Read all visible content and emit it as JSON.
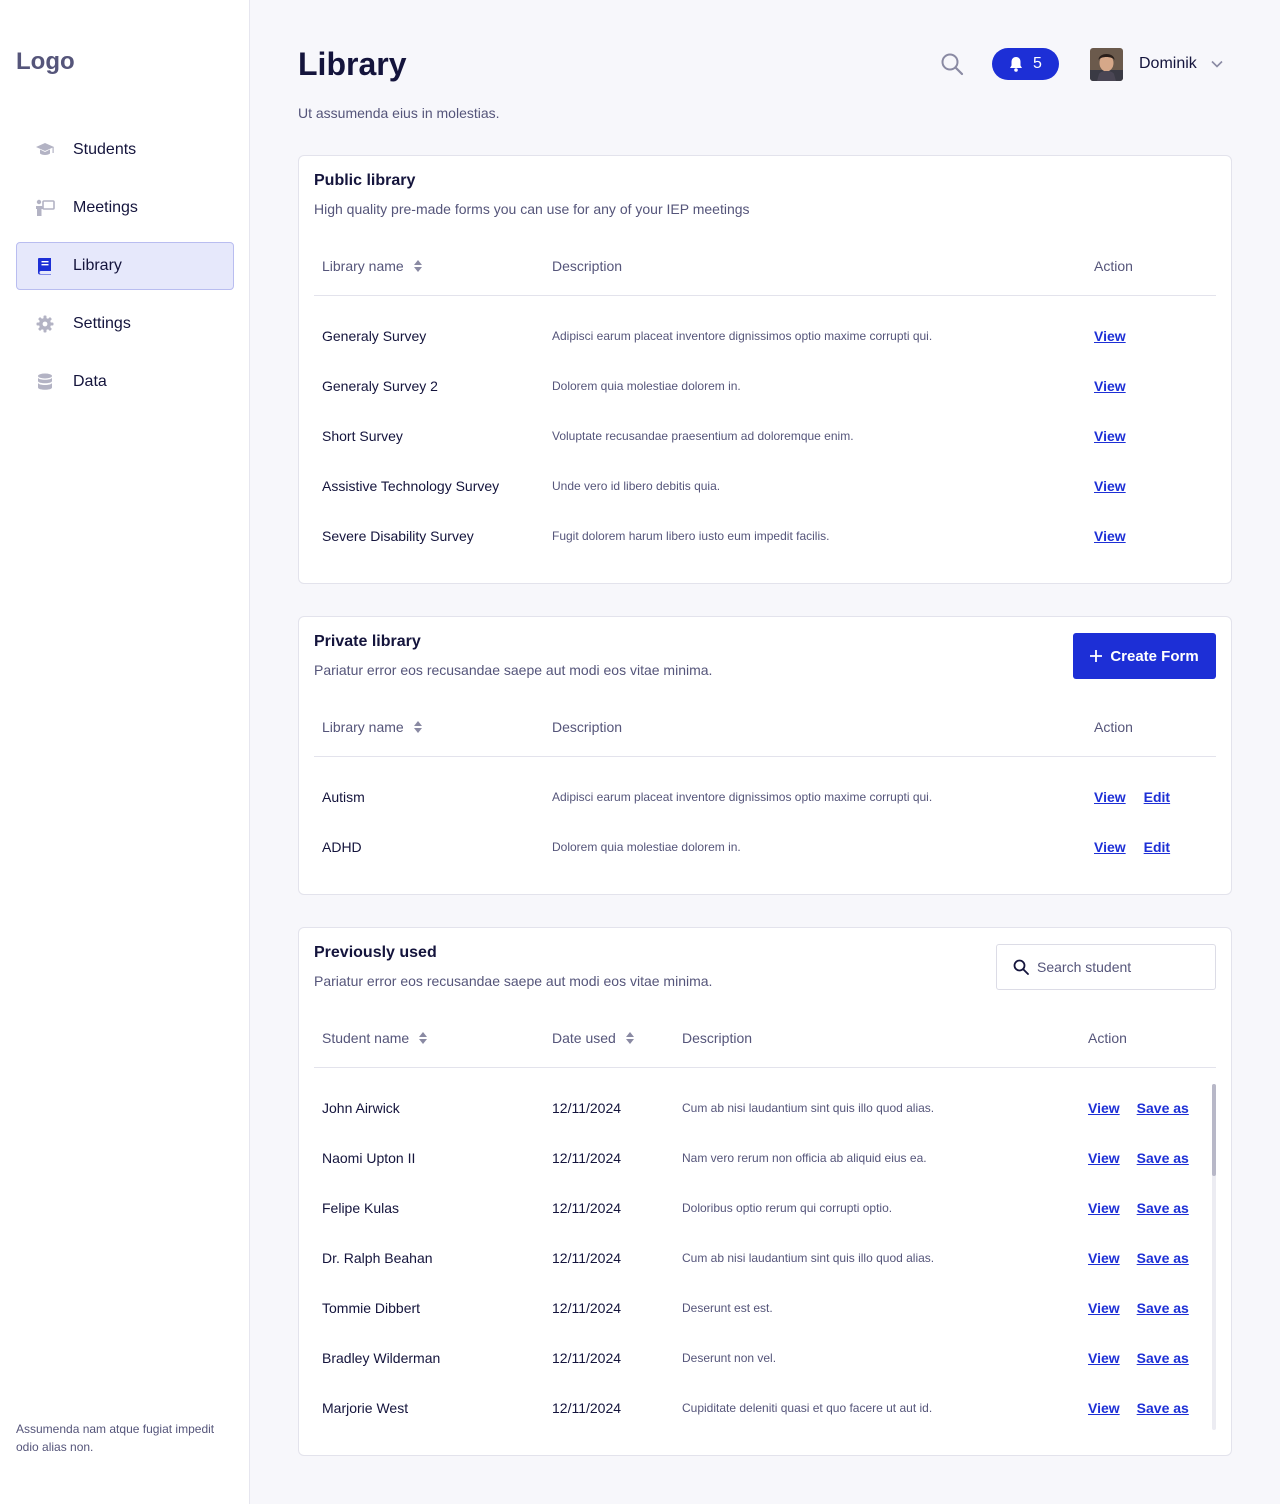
{
  "sidebar": {
    "logo": "Logo",
    "items": [
      {
        "label": "Students",
        "icon": "graduation-cap-icon"
      },
      {
        "label": "Meetings",
        "icon": "presentation-icon"
      },
      {
        "label": "Library",
        "icon": "book-icon",
        "active": true
      },
      {
        "label": "Settings",
        "icon": "gear-icon"
      },
      {
        "label": "Data",
        "icon": "database-icon"
      }
    ],
    "footer": "Assumenda nam atque fugiat impedit odio alias non."
  },
  "header": {
    "title": "Library",
    "subtitle": "Ut assumenda eius in molestias.",
    "notifications": "5",
    "user_name": "Dominik"
  },
  "public_library": {
    "title": "Public library",
    "subtitle": "High quality pre-made forms you can use for any of your IEP meetings",
    "columns": {
      "name": "Library name",
      "description": "Description",
      "action": "Action"
    },
    "rows": [
      {
        "name": "Generaly Survey",
        "description": "Adipisci earum placeat inventore dignissimos optio maxime corrupti qui.",
        "view": "View"
      },
      {
        "name": "Generaly Survey 2",
        "description": "Dolorem quia molestiae dolorem in.",
        "view": "View"
      },
      {
        "name": "Short Survey",
        "description": "Voluptate recusandae praesentium ad doloremque enim.",
        "view": "View"
      },
      {
        "name": "Assistive Technology Survey",
        "description": "Unde vero id libero debitis quia.",
        "view": "View"
      },
      {
        "name": "Severe Disability Survey",
        "description": "Fugit dolorem harum libero iusto eum impedit facilis.",
        "view": "View"
      }
    ]
  },
  "private_library": {
    "title": "Private library",
    "subtitle": "Pariatur error eos recusandae saepe aut modi eos vitae minima.",
    "create_label": "Create Form",
    "columns": {
      "name": "Library name",
      "description": "Description",
      "action": "Action"
    },
    "rows": [
      {
        "name": "Autism",
        "description": "Adipisci earum placeat inventore dignissimos optio maxime corrupti qui.",
        "view": "View",
        "edit": "Edit"
      },
      {
        "name": "ADHD",
        "description": "Dolorem quia molestiae dolorem in.",
        "view": "View",
        "edit": "Edit"
      }
    ]
  },
  "previously_used": {
    "title": "Previously used",
    "subtitle": "Pariatur error eos recusandae saepe aut modi eos vitae minima.",
    "search_placeholder": "Search student",
    "columns": {
      "name": "Student name",
      "date": "Date used",
      "description": "Description",
      "action": "Action"
    },
    "rows": [
      {
        "name": "John Airwick",
        "date": "12/11/2024",
        "description": "Cum ab nisi laudantium sint quis illo quod alias.",
        "view": "View",
        "save": "Save as"
      },
      {
        "name": "Naomi Upton II",
        "date": "12/11/2024",
        "description": "Nam vero rerum non officia ab aliquid eius ea.",
        "view": "View",
        "save": "Save as"
      },
      {
        "name": "Felipe Kulas",
        "date": "12/11/2024",
        "description": "Doloribus optio rerum qui corrupti optio.",
        "view": "View",
        "save": "Save as"
      },
      {
        "name": "Dr. Ralph Beahan",
        "date": "12/11/2024",
        "description": "Cum ab nisi laudantium sint quis illo quod alias.",
        "view": "View",
        "save": "Save as"
      },
      {
        "name": "Tommie Dibbert",
        "date": "12/11/2024",
        "description": "Deserunt est est.",
        "view": "View",
        "save": "Save as"
      },
      {
        "name": "Bradley Wilderman",
        "date": "12/11/2024",
        "description": "Deserunt non vel.",
        "view": "View",
        "save": "Save as"
      },
      {
        "name": "Marjorie West",
        "date": "12/11/2024",
        "description": "Cupiditate deleniti quasi et quo facere ut aut id.",
        "view": "View",
        "save": "Save as"
      }
    ]
  },
  "colors": {
    "accent": "#1d2fd6",
    "text": "#14143c",
    "muted": "#55557a",
    "active_bg": "#e6e8fb"
  }
}
